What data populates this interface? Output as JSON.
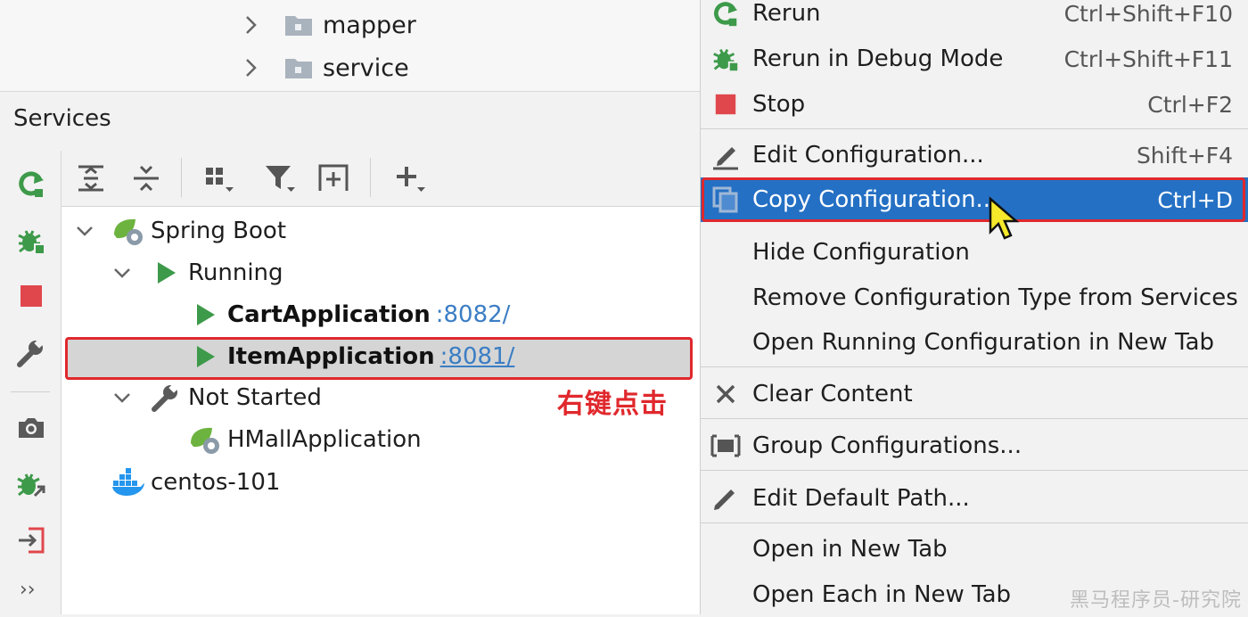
{
  "project_tree": {
    "items": [
      {
        "label": "mapper",
        "icon": "folder-icon"
      },
      {
        "label": "service",
        "icon": "folder-icon"
      }
    ]
  },
  "services": {
    "title": "Services",
    "left_toolbar": [
      "rerun-icon",
      "debug-icon",
      "stop-icon",
      "wrench-icon",
      "camera-icon",
      "debug-attach-icon",
      "import-icon"
    ],
    "more_label": "››",
    "top_toolbar": [
      "expand-all-icon",
      "collapse-all-icon",
      "group-icon",
      "filter-icon",
      "new-tab-icon",
      "add-icon"
    ],
    "tree": {
      "spring_boot": "Spring Boot",
      "running": "Running",
      "cart_app": "CartApplication",
      "cart_port": ":8082/",
      "item_app": "ItemApplication",
      "item_port": ":8081/",
      "not_started": "Not Started",
      "hmall_app": "HMallApplication",
      "docker": "centos-101"
    },
    "annotation": "右键点击"
  },
  "context_menu": {
    "items": [
      {
        "label": "Rerun",
        "shortcut": "Ctrl+Shift+F10",
        "icon": "rerun-icon"
      },
      {
        "label": "Rerun in Debug Mode",
        "shortcut": "Ctrl+Shift+F11",
        "icon": "debug-icon"
      },
      {
        "label": "Stop",
        "shortcut": "Ctrl+F2",
        "icon": "stop-icon"
      },
      {
        "label": "Edit Configuration...",
        "shortcut": "Shift+F4",
        "icon": "edit-icon"
      },
      {
        "label": "Copy Configuration...",
        "shortcut": "Ctrl+D",
        "icon": "copy-icon"
      },
      {
        "label": "Hide Configuration",
        "shortcut": "",
        "icon": ""
      },
      {
        "label": "Remove Configuration Type from Services",
        "shortcut": "",
        "icon": ""
      },
      {
        "label": "Open Running Configuration in New Tab",
        "shortcut": "",
        "icon": ""
      },
      {
        "label": "Clear Content",
        "shortcut": "",
        "icon": "close-icon"
      },
      {
        "label": "Group Configurations...",
        "shortcut": "",
        "icon": "group-icon"
      },
      {
        "label": "Edit Default Path...",
        "shortcut": "",
        "icon": "pencil-icon"
      },
      {
        "label": "Open in New Tab",
        "shortcut": "",
        "icon": ""
      },
      {
        "label": "Open Each in New Tab",
        "shortcut": "",
        "icon": ""
      }
    ],
    "highlighted": "Copy Configuration..."
  },
  "watermark": "黑马程序员-研究院",
  "colors": {
    "accent": "#2470c4",
    "highlight_outline": "#e0282d",
    "run_green": "#3d9a4a",
    "stop_red": "#e0474c",
    "link_blue": "#3b7ec4"
  }
}
